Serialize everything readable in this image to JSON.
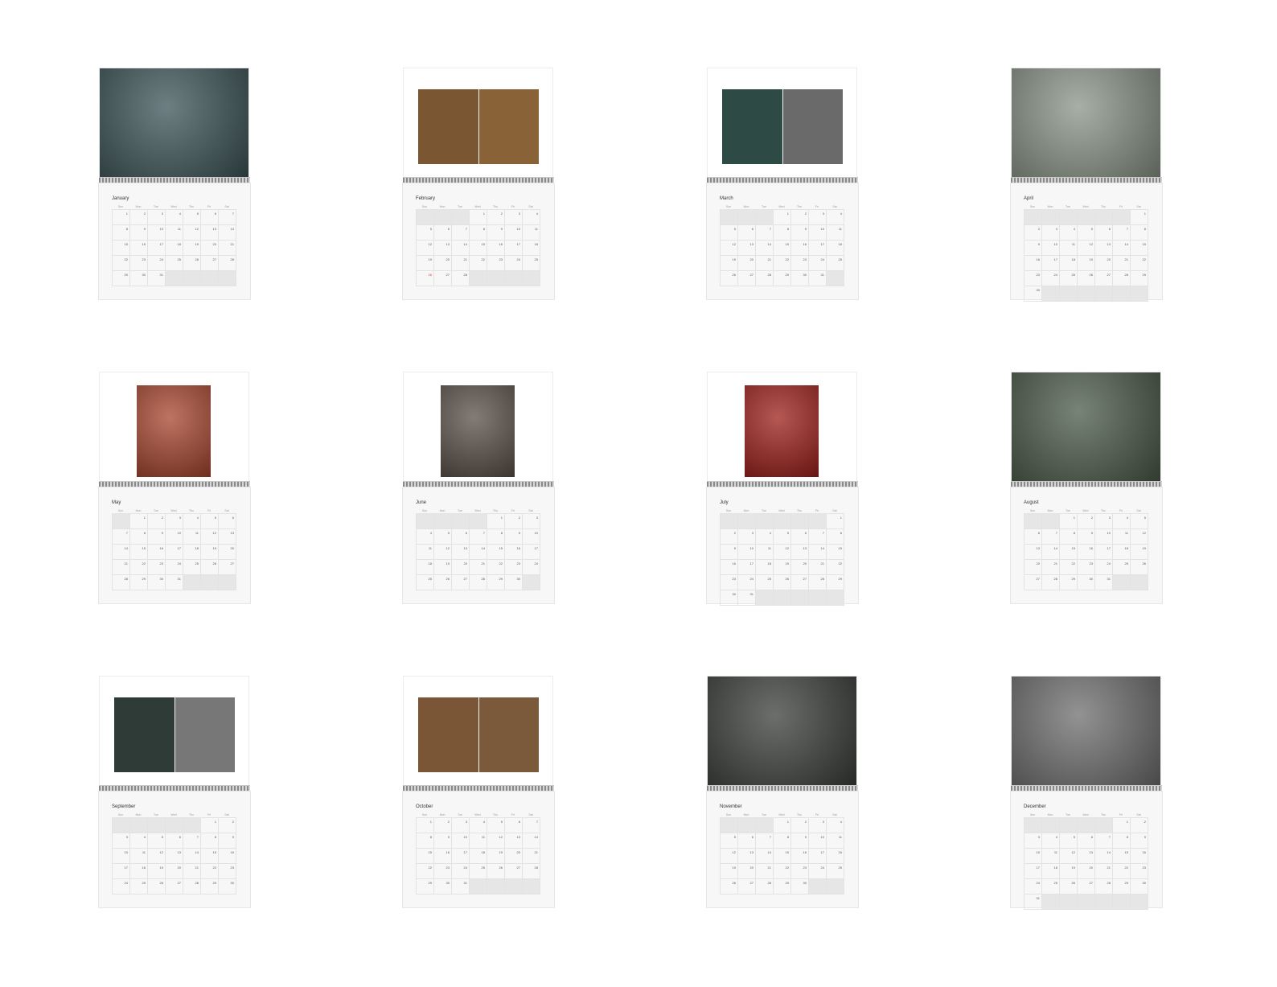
{
  "calendars": [
    {
      "month": "January",
      "layout": "full",
      "photos": [
        "#3c5458"
      ],
      "lead": 0,
      "days": 31,
      "trail": 4,
      "highlight": []
    },
    {
      "month": "February",
      "layout": "double",
      "photos": [
        "#7a5632",
        "#8a6238"
      ],
      "lead": 3,
      "days": 28,
      "trail": 4,
      "highlight": [
        26
      ]
    },
    {
      "month": "March",
      "layout": "double",
      "photos": [
        "#2e4a44",
        "#6a6a6a"
      ],
      "lead": 3,
      "days": 31,
      "trail": 1,
      "highlight": []
    },
    {
      "month": "April",
      "layout": "full",
      "photos": [
        "#8a9488"
      ],
      "lead": 6,
      "days": 30,
      "trail": 6,
      "highlight": []
    },
    {
      "month": "May",
      "layout": "single",
      "photos": [
        "#a8452e"
      ],
      "lead": 1,
      "days": 31,
      "trail": 3,
      "highlight": []
    },
    {
      "month": "June",
      "layout": "single",
      "photos": [
        "#5a5048"
      ],
      "lead": 4,
      "days": 30,
      "trail": 1,
      "highlight": []
    },
    {
      "month": "July",
      "layout": "single",
      "photos": [
        "#9e1f1a"
      ],
      "lead": 6,
      "days": 31,
      "trail": 5,
      "highlight": []
    },
    {
      "month": "August",
      "layout": "full",
      "photos": [
        "#4a5a48"
      ],
      "lead": 2,
      "days": 31,
      "trail": 2,
      "highlight": []
    },
    {
      "month": "September",
      "layout": "double",
      "photos": [
        "#2f3b36",
        "#777777"
      ],
      "lead": 5,
      "days": 30,
      "trail": 0,
      "highlight": []
    },
    {
      "month": "October",
      "layout": "double",
      "photos": [
        "#7a5636",
        "#7a5a3a"
      ],
      "lead": 0,
      "days": 31,
      "trail": 4,
      "highlight": []
    },
    {
      "month": "November",
      "layout": "full",
      "photos": [
        "#3a3e3a"
      ],
      "lead": 3,
      "days": 30,
      "trail": 2,
      "highlight": []
    },
    {
      "month": "December",
      "layout": "full",
      "photos": [
        "#6e6e6e"
      ],
      "lead": 5,
      "days": 31,
      "trail": 6,
      "highlight": []
    }
  ],
  "weekdays": [
    "Sun",
    "Mon",
    "Tue",
    "Wed",
    "Thu",
    "Fri",
    "Sat"
  ]
}
